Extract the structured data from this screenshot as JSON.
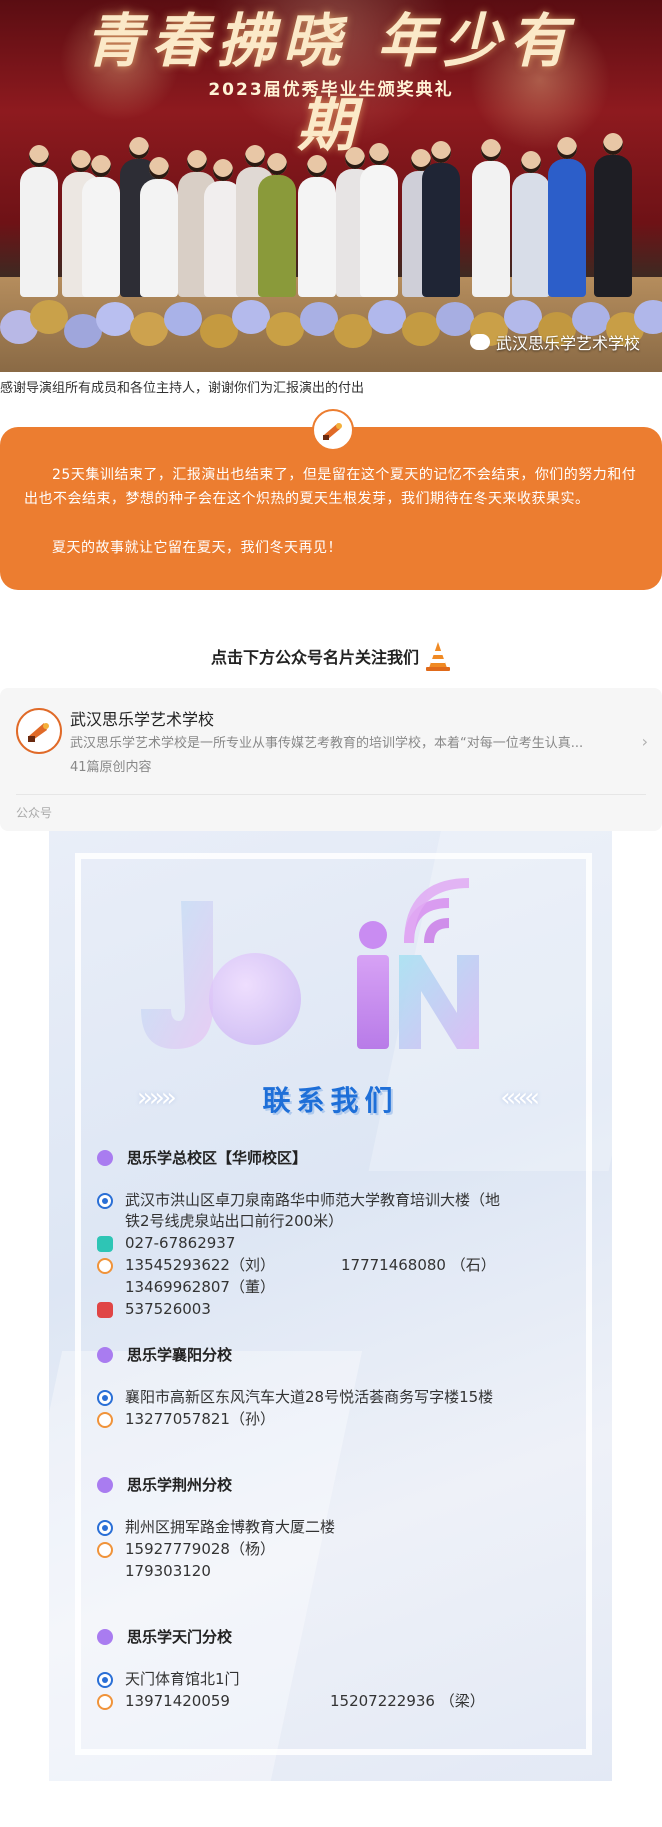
{
  "hero": {
    "banner_title": "青春拂晓 年少有期",
    "banner_subtitle": "2023届优秀毕业生颁奖典礼",
    "watermark": "武汉思乐学艺术学校"
  },
  "caption": "感谢导演组所有成员和各位主持人，谢谢你们为汇报演出的付出",
  "orange_card": {
    "para1": "25天集训结束了，汇报演出也结束了，但是留在这个夏天的记忆不会结束，你们的努力和付出也不会结束，梦想的种子会在这个炽热的夏天生根发芽，我们期待在冬天来收获果实。",
    "para2": "夏天的故事就让它留在夏天，我们冬天再见！"
  },
  "follow_text": "点击下方公众号名片关注我们",
  "account": {
    "name": "武汉思乐学艺术学校",
    "desc": "武汉思乐学艺术学校是一所专业从事传媒艺考教育的培训学校，本着“对每一位考生认真...",
    "count": "41篇原创内容",
    "type": "公众号"
  },
  "poster": {
    "join_word": "JOiN",
    "contact_title": "联系我们",
    "arrows_left": "»»»",
    "arrows_right": "«««",
    "sections": [
      {
        "title": "思乐学总校区【华师校区】",
        "address_line1": "武汉市洪山区卓刀泉南路华中师范大学教育培训大楼（地",
        "address_line2": "铁2号线虎泉站出口前行200米）",
        "tel": "027-67862937",
        "mobile1": "13545293622（刘）",
        "mobile2": "17771468080 （石）",
        "mobile3": "13469962807（董）",
        "qq": "537526003"
      },
      {
        "title": "思乐学襄阳分校",
        "address": "襄阳市高新区东风汽车大道28号悦活荟商务写字楼15楼",
        "mobile1": "13277057821（孙）"
      },
      {
        "title": "思乐学荆州分校",
        "address": "荆州区拥军路金博教育大厦二楼",
        "mobile1": "15927779028（杨）",
        "mobile2": "179303120"
      },
      {
        "title": "思乐学天门分校",
        "address": "天门体育馆北1门",
        "mobile1": "13971420059",
        "mobile2": "15207222936 （梁）"
      }
    ]
  }
}
